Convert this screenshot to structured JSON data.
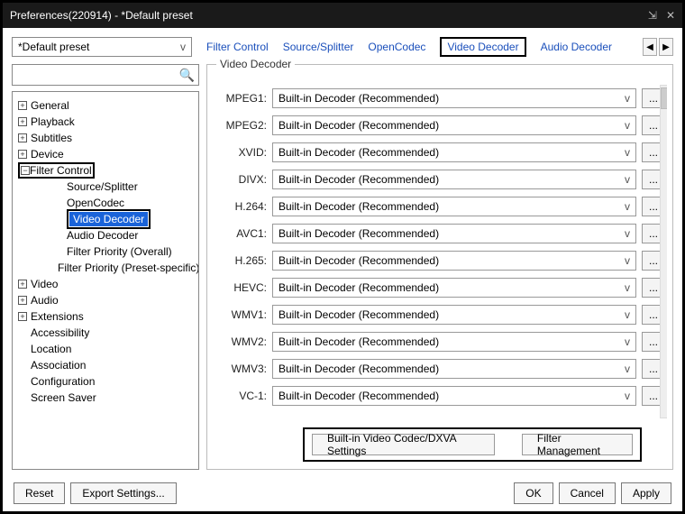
{
  "window": {
    "title": "Preferences(220914) - *Default preset"
  },
  "preset": {
    "selected": "*Default preset"
  },
  "tabs": {
    "items": [
      "Filter Control",
      "Source/Splitter",
      "OpenCodec",
      "Video Decoder",
      "Audio Decoder"
    ],
    "active_index": 3,
    "arrow_left": "◀",
    "arrow_right": "▶"
  },
  "search": {
    "placeholder": ""
  },
  "tree": {
    "items": [
      {
        "label": "General",
        "expandable": true
      },
      {
        "label": "Playback",
        "expandable": true
      },
      {
        "label": "Subtitles",
        "expandable": true
      },
      {
        "label": "Device",
        "expandable": true
      },
      {
        "label": "Filter Control",
        "expandable": true,
        "highlighted": true,
        "expanded": true
      },
      {
        "label": "Source/Splitter",
        "child": true
      },
      {
        "label": "OpenCodec",
        "child": true
      },
      {
        "label": "Video Decoder",
        "child": true,
        "selected": true
      },
      {
        "label": "Audio Decoder",
        "child": true
      },
      {
        "label": "Filter Priority (Overall)",
        "child": true
      },
      {
        "label": "Filter Priority (Preset-specific)",
        "child": true
      },
      {
        "label": "Video",
        "expandable": true
      },
      {
        "label": "Audio",
        "expandable": true
      },
      {
        "label": "Extensions",
        "expandable": true
      },
      {
        "label": "Accessibility"
      },
      {
        "label": "Location"
      },
      {
        "label": "Association"
      },
      {
        "label": "Configuration"
      },
      {
        "label": "Screen Saver"
      }
    ]
  },
  "group": {
    "title": "Video Decoder",
    "default_option": "Built-in Decoder (Recommended)",
    "rows": [
      {
        "label": "MPEG1:"
      },
      {
        "label": "MPEG2:"
      },
      {
        "label": "XVID:"
      },
      {
        "label": "DIVX:"
      },
      {
        "label": "H.264:"
      },
      {
        "label": "AVC1:"
      },
      {
        "label": "H.265:"
      },
      {
        "label": "HEVC:"
      },
      {
        "label": "WMV1:"
      },
      {
        "label": "WMV2:"
      },
      {
        "label": "WMV3:"
      },
      {
        "label": "VC-1:"
      }
    ],
    "dxva_button": "Built-in Video Codec/DXVA Settings",
    "filter_mgmt_button": "Filter Management"
  },
  "footer": {
    "reset": "Reset",
    "export": "Export Settings...",
    "ok": "OK",
    "cancel": "Cancel",
    "apply": "Apply"
  },
  "glyphs": {
    "dropdown_v": "v",
    "more": "...",
    "plus": "+",
    "minus": "−",
    "pin": "⇲",
    "close": "✕",
    "search": "🔍"
  }
}
